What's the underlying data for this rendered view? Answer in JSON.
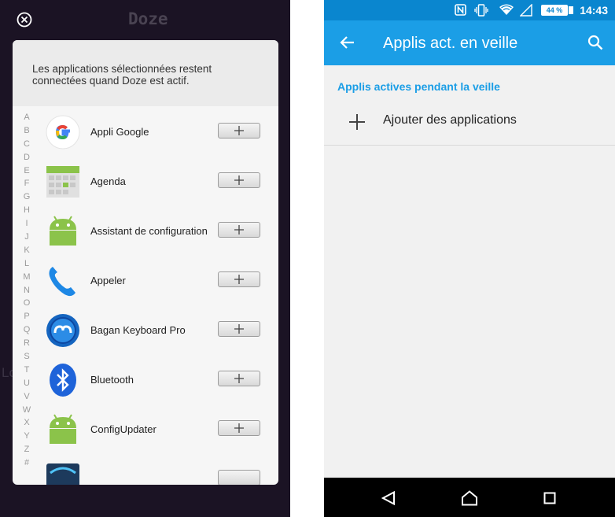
{
  "left": {
    "app_title": "Doze",
    "dialog_message": "Les applications sélectionnées restent connectées quand Doze est actif.",
    "alphabet": [
      "A",
      "B",
      "C",
      "D",
      "E",
      "F",
      "G",
      "H",
      "I",
      "J",
      "K",
      "L",
      "M",
      "N",
      "O",
      "P",
      "Q",
      "R",
      "S",
      "T",
      "U",
      "V",
      "W",
      "X",
      "Y",
      "Z",
      "#"
    ],
    "apps": [
      {
        "name": "Appli Google",
        "icon": "google-icon"
      },
      {
        "name": "Agenda",
        "icon": "calendar-icon"
      },
      {
        "name": "Assistant de configuration",
        "icon": "android-icon"
      },
      {
        "name": "Appeler",
        "icon": "phone-icon"
      },
      {
        "name": "Bagan Keyboard Pro",
        "icon": "keyboard-app-icon"
      },
      {
        "name": "Bluetooth",
        "icon": "bluetooth-icon"
      },
      {
        "name": "ConfigUpdater",
        "icon": "android-icon"
      }
    ]
  },
  "right": {
    "status": {
      "battery": "44 %",
      "time": "14:43"
    },
    "title": "Applis act. en veille",
    "section_label": "Applis actives pendant la veille",
    "add_label": "Ajouter des applications",
    "colors": {
      "accent": "#1b9ee6",
      "statusbar": "#0a86cf"
    }
  }
}
